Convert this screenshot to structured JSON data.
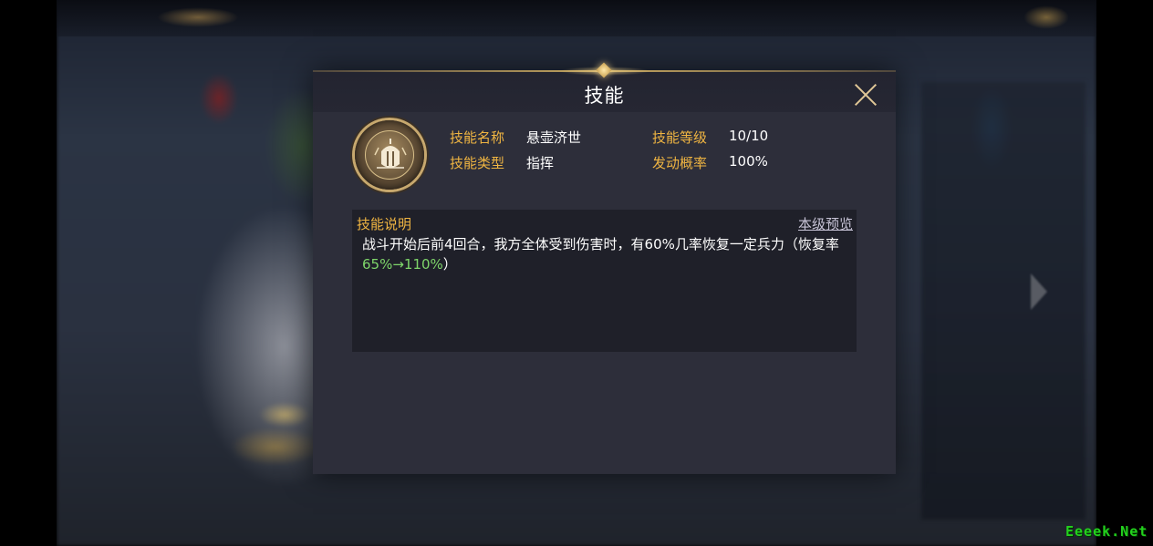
{
  "dialog": {
    "title": "技能",
    "close_icon": "close-icon"
  },
  "skill": {
    "icon": "shield-helmet-icon",
    "name_label": "技能名称",
    "name_value": "悬壶济世",
    "type_label": "技能类型",
    "type_value": "指挥",
    "level_label": "技能等级",
    "level_value": "10/10",
    "rate_label": "发动概率",
    "rate_value": "100%"
  },
  "description": {
    "heading": "技能说明",
    "preview_link": "本级预览",
    "text_before": "战斗开始后前4回合，我方全体受到伤害时，有60%几率恢复一定兵力（恢复率",
    "text_highlight": "65%→110%",
    "text_after": "）"
  },
  "colors": {
    "label_gold": "#f0b542",
    "highlight_green": "#7ed56a",
    "dialog_bg": "#2c2d39",
    "desc_bg": "#1f2029"
  },
  "watermark": "Eeeek.Net"
}
